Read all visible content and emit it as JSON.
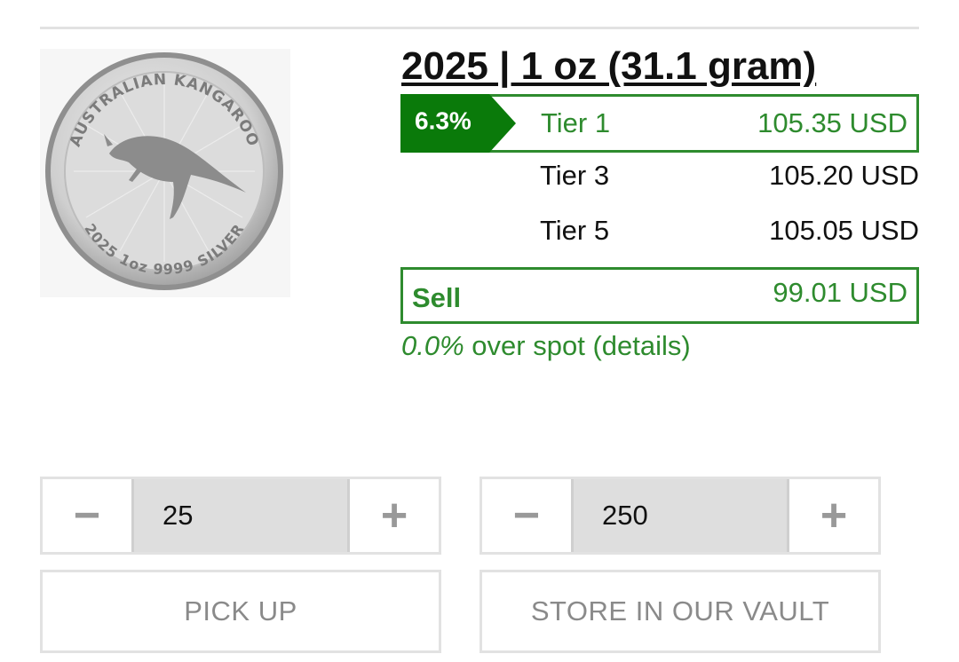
{
  "product": {
    "title": "2025 | 1 oz (31.1 gram)",
    "coin_image": {
      "top_text": "AUSTRALIAN KANGAROO",
      "bottom_text": "2025 1oz 9999 SILVER"
    }
  },
  "pricing": {
    "discount_badge": "6.3%",
    "tiers": [
      {
        "name": "Tier 1",
        "price": "105.35 USD"
      },
      {
        "name": "Tier 3",
        "price": "105.20 USD"
      },
      {
        "name": "Tier 5",
        "price": "105.05 USD"
      }
    ],
    "sell": {
      "label": "Sell",
      "price": "99.01 USD"
    },
    "spot": {
      "percent": "0.0%",
      "text": "over spot",
      "details_link": "(details)"
    }
  },
  "colors": {
    "accent_green": "#2e8b2e",
    "badge_green": "#0a7a0a",
    "border_gray": "#e2e2e2"
  },
  "order": {
    "pickup": {
      "minus": "−",
      "quantity": "25",
      "plus": "+",
      "button": "PICK UP"
    },
    "vault": {
      "minus": "−",
      "quantity": "250",
      "plus": "+",
      "button": "STORE IN OUR VAULT"
    }
  }
}
